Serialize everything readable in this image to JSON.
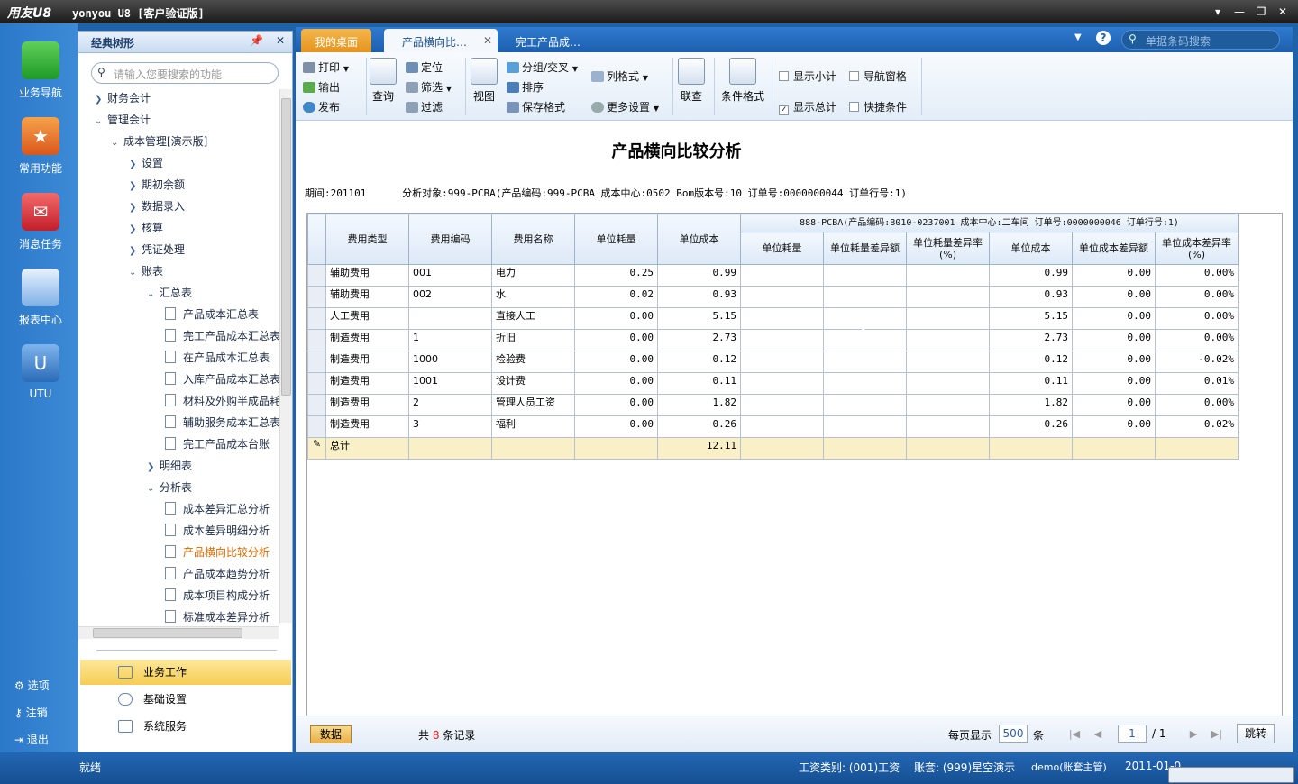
{
  "window": {
    "logo": "用友U8",
    "title": "yonyou U8 [客户验证版]"
  },
  "leftbar": {
    "items": [
      "业务导航",
      "常用功能",
      "消息任务",
      "报表中心",
      "UTU"
    ],
    "bottom": [
      "选项",
      "注销",
      "退出"
    ]
  },
  "nav": {
    "title": "经典树形",
    "search_placeholder": "请输入您要搜索的功能",
    "tree": [
      "财务会计",
      "管理会计",
      "成本管理[演示版]",
      "设置",
      "期初余额",
      "数据录入",
      "核算",
      "凭证处理",
      "账表",
      "汇总表",
      "产品成本汇总表",
      "完工产品成本汇总表",
      "在产品成本汇总表",
      "入库产品成本汇总表",
      "材料及外购半成品耗",
      "辅助服务成本汇总表",
      "完工产品成本台账",
      "明细表",
      "分析表",
      "成本差异汇总分析",
      "成本差异明细分析",
      "产品横向比较分析",
      "产品成本趋势分析",
      "成本项目构成分析",
      "标准成本差异分析"
    ],
    "groups": [
      "业务工作",
      "基础设置",
      "系统服务"
    ]
  },
  "tabs": [
    "我的桌面",
    "产品横向比…",
    "完工产品成…"
  ],
  "search": {
    "placeholder": "单据条码搜索"
  },
  "toolbar": {
    "print": "打印",
    "export": "输出",
    "publish": "发布",
    "query": "查询",
    "locate": "定位",
    "filter": "筛选",
    "filter2": "过滤",
    "view": "视图",
    "group": "分组/交叉",
    "sort": "排序",
    "save_format": "保存格式",
    "col_format": "列格式",
    "more_settings": "更多设置",
    "link": "联查",
    "cond_format": "条件格式",
    "show_subtotal": "显示小计",
    "nav_pane": "导航窗格",
    "show_total": "显示总计",
    "quick_cond": "快捷条件"
  },
  "report": {
    "title": "产品横向比较分析",
    "period": "期间:201101",
    "target": "分析对象:999-PCBA(产品编码:999-PCBA 成本中心:0502 Bom版本号:10 订单号:0000000044 订单行号:1)",
    "group_header": "888-PCBA(产品编码:B010-0237001 成本中心:二车间 订单号:0000000046 订单行号:1)",
    "columns": [
      "费用类型",
      "费用编码",
      "费用名称",
      "单位耗量",
      "单位成本"
    ],
    "sub_columns": [
      "单位耗量",
      "单位耗量差异额",
      "单位耗量差异率(%)",
      "单位成本",
      "单位成本差异额",
      "单位成本差异率(%)"
    ],
    "rows": [
      [
        "辅助费用",
        "001",
        "电力",
        "0.25",
        "0.99",
        "",
        "",
        "",
        "0.99",
        "0.00",
        "0.00%"
      ],
      [
        "辅助费用",
        "002",
        "水",
        "0.02",
        "0.93",
        "",
        "",
        "",
        "0.93",
        "0.00",
        "0.00%"
      ],
      [
        "人工费用",
        "",
        "直接人工",
        "0.00",
        "5.15",
        "",
        "",
        "",
        "5.15",
        "0.00",
        "0.00%"
      ],
      [
        "制造费用",
        "1",
        "折旧",
        "0.00",
        "2.73",
        "",
        "",
        "",
        "2.73",
        "0.00",
        "0.00%"
      ],
      [
        "制造费用",
        "1000",
        "检验费",
        "0.00",
        "0.12",
        "",
        "",
        "",
        "0.12",
        "0.00",
        "-0.02%"
      ],
      [
        "制造费用",
        "1001",
        "设计费",
        "0.00",
        "0.11",
        "",
        "",
        "",
        "0.11",
        "0.00",
        "0.01%"
      ],
      [
        "制造费用",
        "2",
        "管理人员工资",
        "0.00",
        "1.82",
        "",
        "",
        "",
        "1.82",
        "0.00",
        "0.00%"
      ],
      [
        "制造费用",
        "3",
        "福利",
        "0.00",
        "0.26",
        "",
        "",
        "",
        "0.26",
        "0.00",
        "0.02%"
      ]
    ],
    "total_label": "总计",
    "total_unit_cost": "12.11"
  },
  "footer": {
    "data_btn": "数据",
    "records_prefix": "共",
    "records_count": "8",
    "records_suffix": "条记录",
    "per_page_label": "每页显示",
    "per_page": "500",
    "per_page_unit": "条",
    "page": "1",
    "page_total": "/ 1",
    "jump": "跳转"
  },
  "status": {
    "ready": "就绪",
    "wage": "工资类别: (001)工资",
    "account": "账套: (999)星空演示",
    "user": "demo(账套主管)",
    "date": "2011-01-0"
  }
}
